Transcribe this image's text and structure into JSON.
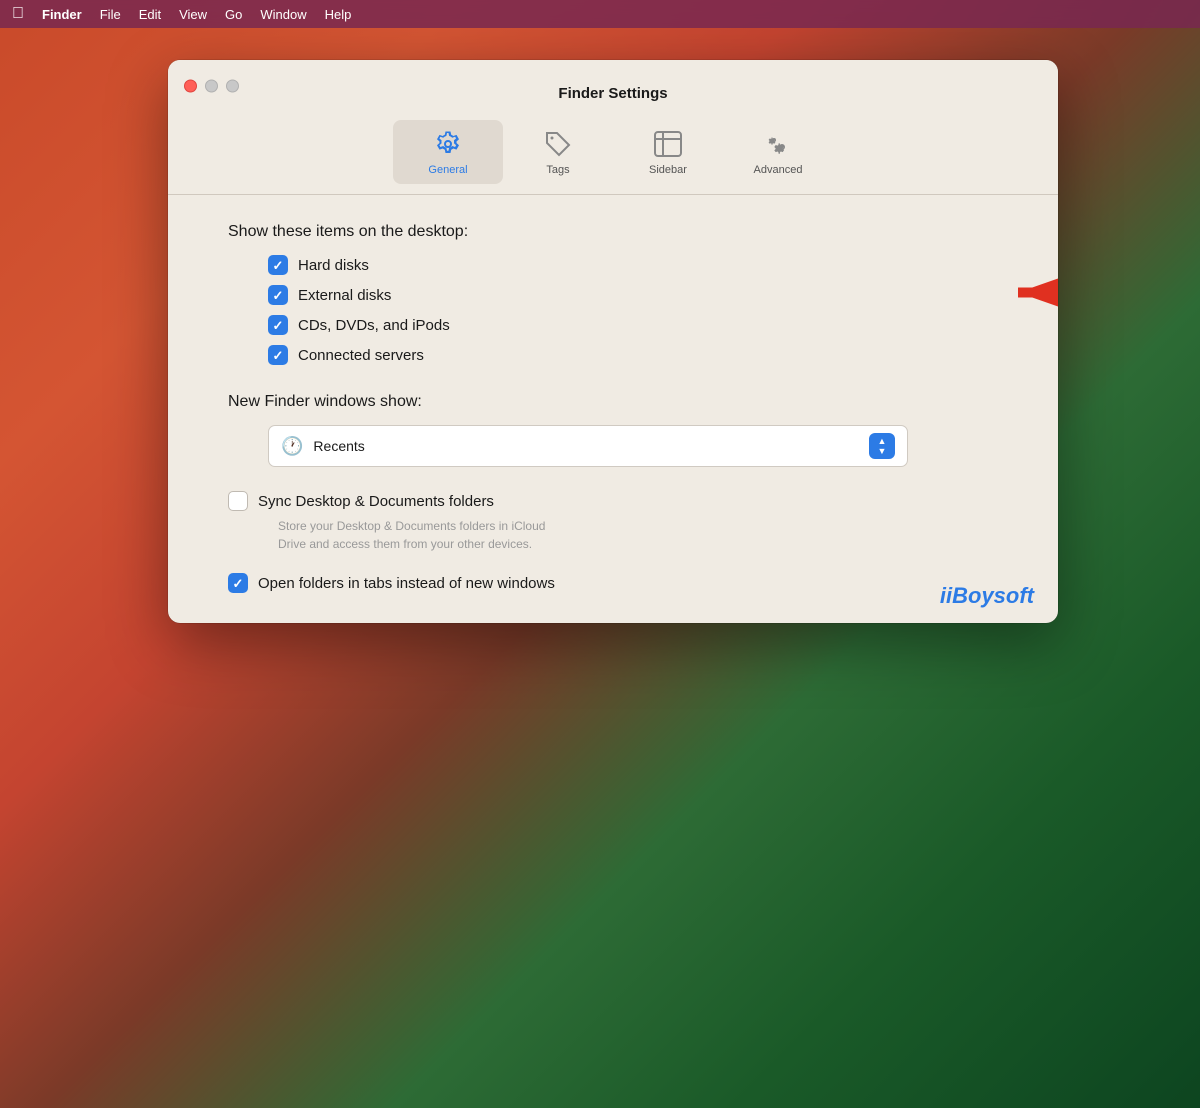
{
  "desktop": {
    "bg_description": "macOS Big Sur gradient background"
  },
  "menubar": {
    "apple": "🍎",
    "items": [
      {
        "label": "Finder",
        "bold": true
      },
      {
        "label": "File",
        "bold": false
      },
      {
        "label": "Edit",
        "bold": false
      },
      {
        "label": "View",
        "bold": false
      },
      {
        "label": "Go",
        "bold": false
      },
      {
        "label": "Window",
        "bold": false
      },
      {
        "label": "Help",
        "bold": false
      }
    ]
  },
  "window": {
    "title": "Finder Settings",
    "tabs": [
      {
        "id": "general",
        "label": "General",
        "active": true
      },
      {
        "id": "tags",
        "label": "Tags",
        "active": false
      },
      {
        "id": "sidebar",
        "label": "Sidebar",
        "active": false
      },
      {
        "id": "advanced",
        "label": "Advanced",
        "active": false
      }
    ]
  },
  "content": {
    "desktop_section_label": "Show these items on the desktop:",
    "checkboxes": [
      {
        "label": "Hard disks",
        "checked": true
      },
      {
        "label": "External disks",
        "checked": true,
        "has_arrow": true
      },
      {
        "label": "CDs, DVDs, and iPods",
        "checked": true
      },
      {
        "label": "Connected servers",
        "checked": true
      }
    ],
    "finder_windows_label": "New Finder windows show:",
    "dropdown_value": "Recents",
    "sync_label": "Sync Desktop & Documents folders",
    "sync_checked": false,
    "sync_description": "Store your Desktop & Documents folders in iCloud\nDrive and access them from your other devices.",
    "open_folders_label": "Open folders in tabs instead of new windows",
    "open_folders_checked": true
  },
  "watermark": {
    "text": "iBoysoft"
  },
  "colors": {
    "accent_blue": "#2c7be5",
    "checkbox_blue": "#2c7be5",
    "window_bg": "#f0ebe3",
    "red_arrow": "#e03020"
  }
}
